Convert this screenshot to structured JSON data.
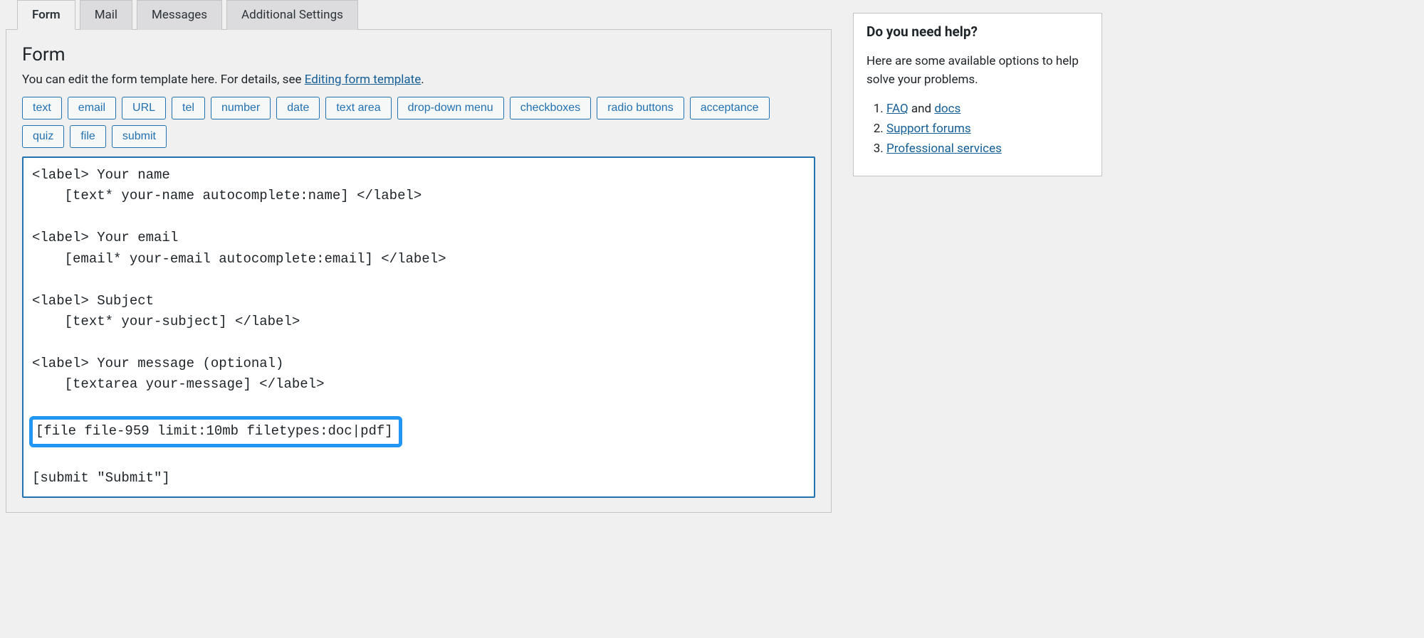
{
  "tabs": [
    {
      "label": "Form",
      "active": true
    },
    {
      "label": "Mail",
      "active": false
    },
    {
      "label": "Messages",
      "active": false
    },
    {
      "label": "Additional Settings",
      "active": false
    }
  ],
  "form_panel": {
    "heading": "Form",
    "description_prefix": "You can edit the form template here. For details, see ",
    "description_link": "Editing form template",
    "description_suffix": ".",
    "tag_buttons": [
      "text",
      "email",
      "URL",
      "tel",
      "number",
      "date",
      "text area",
      "drop-down menu",
      "checkboxes",
      "radio buttons",
      "acceptance",
      "quiz",
      "file",
      "submit"
    ],
    "code_lines": {
      "l1": "<label> Your name",
      "l2": "    [text* your-name autocomplete:name] </label>",
      "l3": "",
      "l4": "<label> Your email",
      "l5": "    [email* your-email autocomplete:email] </label>",
      "l6": "",
      "l7": "<label> Subject",
      "l8": "    [text* your-subject] </label>",
      "l9": "",
      "l10": "<label> Your message (optional)",
      "l11": "    [textarea your-message] </label>",
      "l12": "",
      "highlight": "[file file-959 limit:10mb filetypes:doc|pdf]",
      "l14": "",
      "l15": "[submit \"Submit\"]"
    }
  },
  "help_box": {
    "title": "Do you need help?",
    "intro": "Here are some available options to help solve your problems.",
    "items": [
      {
        "link1": "FAQ",
        "between": " and ",
        "link2": "docs"
      },
      {
        "link1": "Support forums"
      },
      {
        "link1": "Professional services"
      }
    ]
  }
}
